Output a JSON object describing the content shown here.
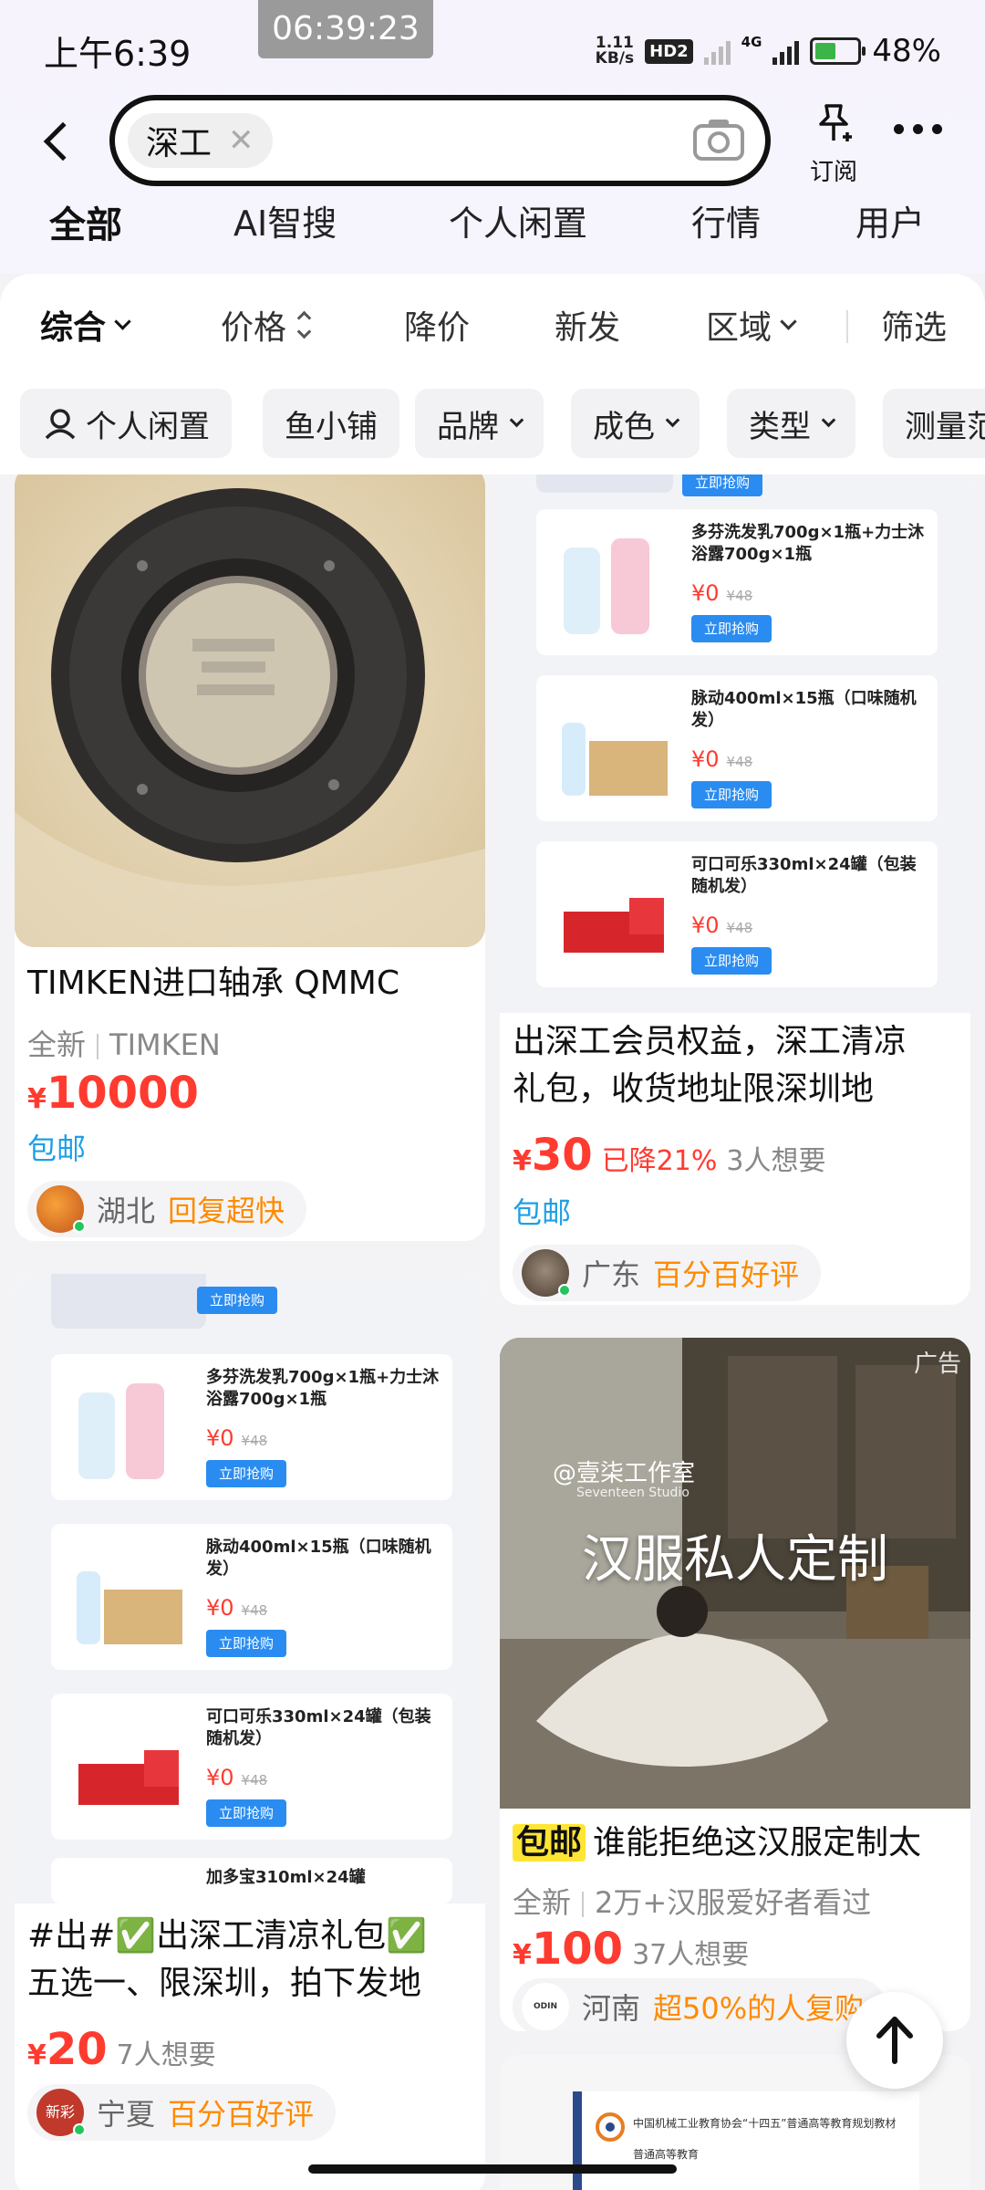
{
  "status_bar": {
    "time": "上午6:39",
    "screen_timer": "06:39:23",
    "net_speed_value": "1.11",
    "net_speed_unit": "KB/s",
    "hd_label": "HD2",
    "network": "4G",
    "battery": "48%",
    "battery_level": 0.48
  },
  "search": {
    "keyword": "深工",
    "subscribe_label": "订阅"
  },
  "tabs": [
    "全部",
    "AI智搜",
    "个人闲置",
    "行情",
    "用户"
  ],
  "sort": [
    "综合",
    "价格",
    "降价",
    "新发",
    "区域",
    "筛选"
  ],
  "filters": [
    "个人闲置",
    "鱼小铺",
    "品牌",
    "成色",
    "类型",
    "测量范"
  ],
  "promo_items": [
    {
      "name": "多芬洗发乳700g×1瓶+力士沐浴露700g×1瓶",
      "price": "¥0",
      "orig": "¥48",
      "button": "立即抢购"
    },
    {
      "name": "脉动400ml×15瓶（口味随机发）",
      "price": "¥0",
      "orig": "¥48",
      "button": "立即抢购"
    },
    {
      "name": "可口可乐330ml×24罐（包装随机发）",
      "price": "¥0",
      "orig": "¥48",
      "button": "立即抢购"
    }
  ],
  "promo_top_button": "立即抢购",
  "promo_bottom_text": "加多宝310ml×24罐",
  "cards": {
    "c1": {
      "title": "TIMKEN进口轴承 QMMC",
      "condition": "全新",
      "brand": "TIMKEN",
      "price_symbol": "¥",
      "price": "10000",
      "shipping": "包邮",
      "seller_region": "湖北",
      "seller_tag": "回复超快"
    },
    "c2": {
      "title_line1": "出深工会员权益，深工清凉",
      "title_line2": "礼包，收货地址限深圳地",
      "price_symbol": "¥",
      "price": "30",
      "drop": "已降21%",
      "wants": "3人想要",
      "shipping": "包邮",
      "seller_region": "广东",
      "seller_tag": "百分百好评"
    },
    "c3": {
      "title_line1": "#出#✅出深工清凉礼包✅",
      "title_line2": "五选一、限深圳，拍下发地",
      "price_symbol": "¥",
      "price": "20",
      "wants": "7人想要",
      "seller_avatar_text": "新彩",
      "seller_region": "宁夏",
      "seller_tag": "百分百好评"
    },
    "c4": {
      "ad_label": "广告",
      "studio": "@壹柒工作室",
      "studio_en": "Seventeen Studio",
      "headline": "汉服私人定制",
      "badge": "包邮",
      "title": "谁能拒绝这汉服定制太",
      "condition": "全新",
      "views": "2万+汉服爱好者看过",
      "price_symbol": "¥",
      "price": "100",
      "wants": "37人想要",
      "seller_avatar_text": "ODIN SEVEN",
      "seller_region": "河南",
      "seller_tag": "超50%的人复购"
    },
    "c5": {
      "line1": "中国机械工业教育协会“十四五”普通高等教育规划教材",
      "line2": "普通高等教育"
    }
  }
}
